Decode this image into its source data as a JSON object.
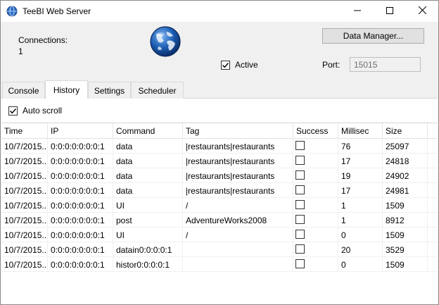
{
  "window": {
    "title": "TeeBI Web Server"
  },
  "top_panel": {
    "connections_label": "Connections:",
    "connections_value": "1",
    "data_manager_label": "Data Manager...",
    "active_label": "Active",
    "active_checked": true,
    "port_label": "Port:",
    "port_value": "15015"
  },
  "tabs": [
    {
      "label": "Console",
      "selected": false
    },
    {
      "label": "History",
      "selected": true
    },
    {
      "label": "Settings",
      "selected": false
    },
    {
      "label": "Scheduler",
      "selected": false
    }
  ],
  "history": {
    "autoscroll_label": "Auto scroll",
    "autoscroll_checked": true,
    "columns": [
      "Time",
      "IP",
      "Command",
      "Tag",
      "Success",
      "Millisec",
      "Size"
    ],
    "rows": [
      {
        "time": "10/7/2015...",
        "ip": "0:0:0:0:0:0:0:1",
        "command": "data",
        "tag": "|restaurants|restaurants",
        "success": false,
        "millisec": "76",
        "size": "25097"
      },
      {
        "time": "10/7/2015...",
        "ip": "0:0:0:0:0:0:0:1",
        "command": "data",
        "tag": "|restaurants|restaurants",
        "success": false,
        "millisec": "17",
        "size": "24818"
      },
      {
        "time": "10/7/2015...",
        "ip": "0:0:0:0:0:0:0:1",
        "command": "data",
        "tag": "|restaurants|restaurants",
        "success": false,
        "millisec": "19",
        "size": "24902"
      },
      {
        "time": "10/7/2015...",
        "ip": "0:0:0:0:0:0:0:1",
        "command": "data",
        "tag": "|restaurants|restaurants",
        "success": false,
        "millisec": "17",
        "size": "24981"
      },
      {
        "time": "10/7/2015...",
        "ip": "0:0:0:0:0:0:0:1",
        "command": "UI",
        "tag": "/",
        "success": false,
        "millisec": "1",
        "size": "1509"
      },
      {
        "time": "10/7/2015...",
        "ip": "0:0:0:0:0:0:0:1",
        "command": "post",
        "tag": "AdventureWorks2008",
        "success": false,
        "millisec": "1",
        "size": "8912"
      },
      {
        "time": "10/7/2015...",
        "ip": "0:0:0:0:0:0:0:1",
        "command": "UI",
        "tag": "/",
        "success": false,
        "millisec": "0",
        "size": "1509"
      },
      {
        "time": "10/7/2015...",
        "ip": "0:0:0:0:0:0:0:1",
        "command": "datain0:0:0:0:1",
        "tag": "",
        "success": false,
        "millisec": "20",
        "size": "3529"
      },
      {
        "time": "10/7/2015...",
        "ip": "0:0:0:0:0:0:0:1",
        "command": "histor0:0:0:0:1",
        "tag": "",
        "success": false,
        "millisec": "0",
        "size": "1509"
      }
    ]
  },
  "icons": {
    "app": "globe-icon",
    "logo": "globe-icon",
    "minimize": "minimize-icon",
    "maximize": "maximize-icon",
    "close": "close-icon",
    "check": "checkmark-icon"
  },
  "colors": {
    "window_bg": "#f0f0f0",
    "content_bg": "#ffffff",
    "button_bg": "#e1e1e1",
    "globe_blue": "#1d5fb4"
  }
}
